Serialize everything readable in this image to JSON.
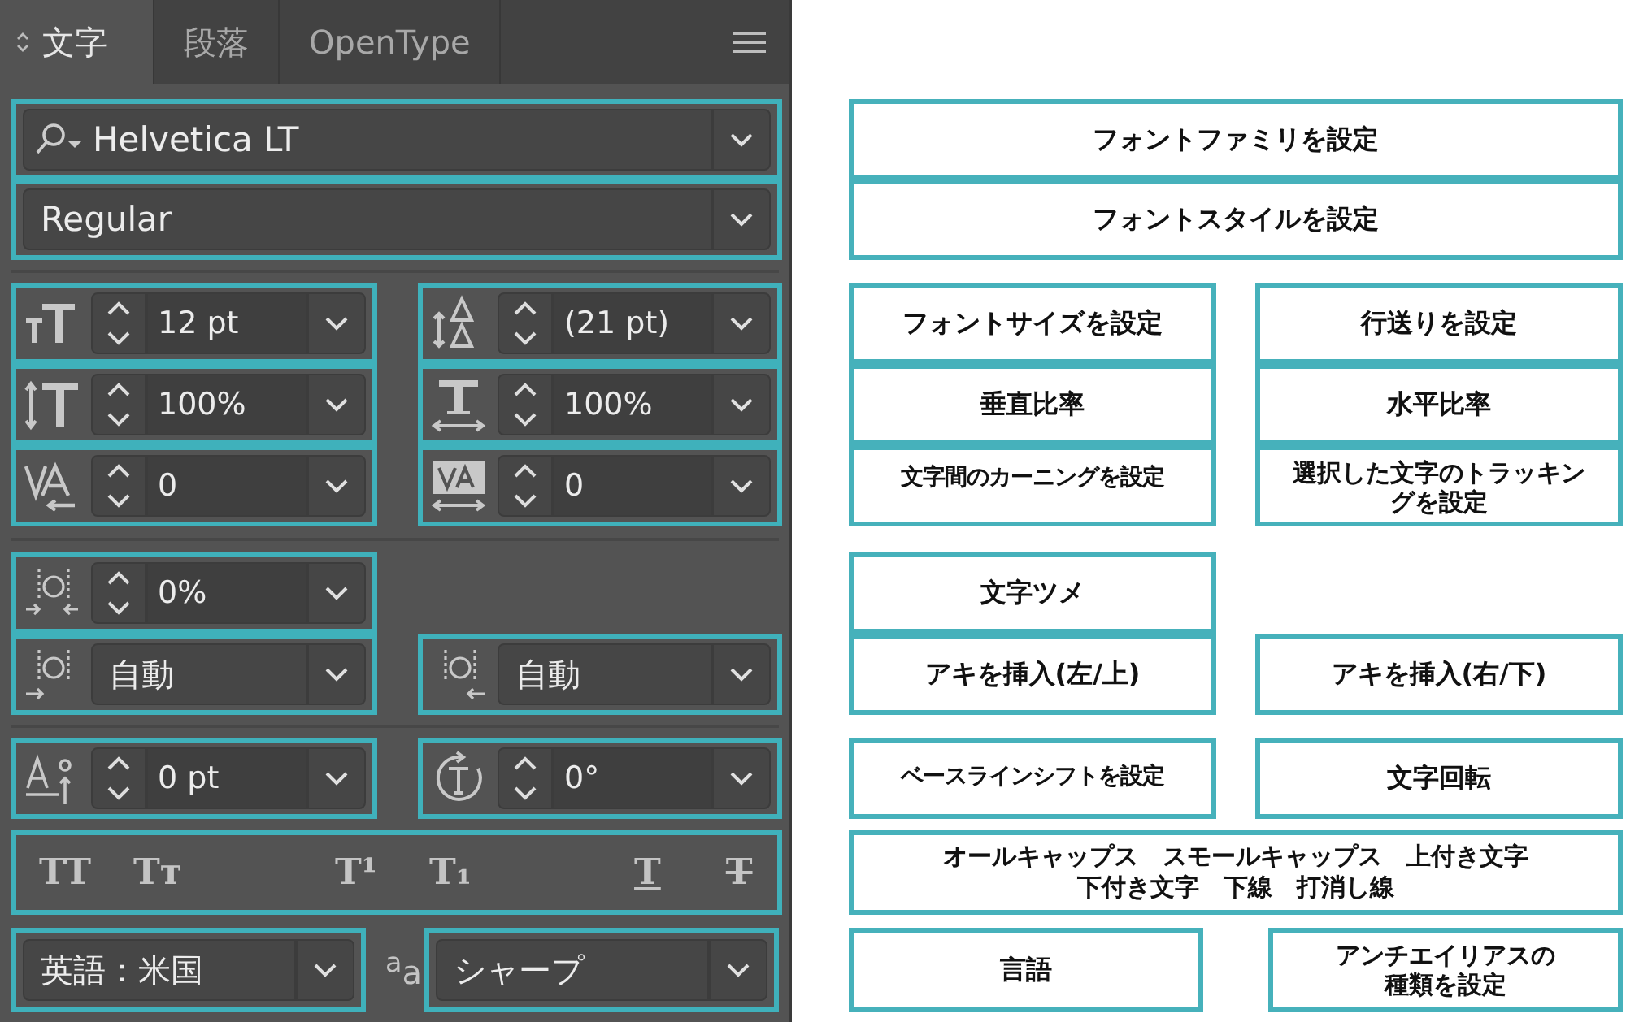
{
  "tabs": [
    {
      "label": "文字",
      "selected": true
    },
    {
      "label": "段落",
      "selected": false
    },
    {
      "label": "OpenType",
      "selected": false
    }
  ],
  "font_family": {
    "value": "Helvetica LT"
  },
  "font_style": {
    "value": "Regular"
  },
  "size_controls": [
    {
      "kind": "spinner",
      "value": "12 pt"
    },
    {
      "kind": "spinner",
      "value": "(21 pt)"
    },
    {
      "kind": "spinner",
      "value": "100%"
    },
    {
      "kind": "spinner",
      "value": "100%"
    },
    {
      "kind": "spinner",
      "value": "0"
    },
    {
      "kind": "spinner",
      "value": "0"
    }
  ],
  "spacing_controls": [
    {
      "kind": "spinner",
      "value": "0%"
    },
    {
      "kind": "dropdown",
      "value": "自動"
    },
    {
      "kind": "dropdown",
      "value": "自動"
    }
  ],
  "shift_controls": [
    {
      "kind": "spinner",
      "value": "0 pt"
    },
    {
      "kind": "spinner",
      "value": "0°"
    }
  ],
  "style_buttons": [
    {
      "kind": "all-caps",
      "glyph": "TT"
    },
    {
      "kind": "small-caps",
      "glyph": "Tᴛ"
    },
    {
      "kind": "superscript",
      "glyph": "T¹"
    },
    {
      "kind": "subscript",
      "glyph": "T₁"
    },
    {
      "kind": "underline",
      "glyph": "T"
    },
    {
      "kind": "strikethrough",
      "glyph": "T"
    }
  ],
  "language": {
    "value": "英語：米国"
  },
  "antialias_icon": "$^{a}$a",
  "antialias": {
    "value": "シャープ"
  },
  "annotations": {
    "font": [
      "フォントファミリを設定",
      "フォントスタイルを設定"
    ],
    "size": [
      "フォントサイズを設定",
      "行送りを設定",
      "垂直比率",
      "水平比率",
      "文字間のカーニングを設定",
      "選択した文字のトラッキングを設定"
    ],
    "spacing": [
      "文字ツメ",
      "アキを挿入(左/上)",
      "アキを挿入(右/下)"
    ],
    "shift": [
      "ベースラインシフトを設定",
      "文字回転"
    ],
    "styles": "オールキャップス　スモールキャップス　上付き文字下付き文字　下線　打消し線",
    "language": [
      "言語",
      "アンチエイリアスの種類を設定"
    ]
  }
}
